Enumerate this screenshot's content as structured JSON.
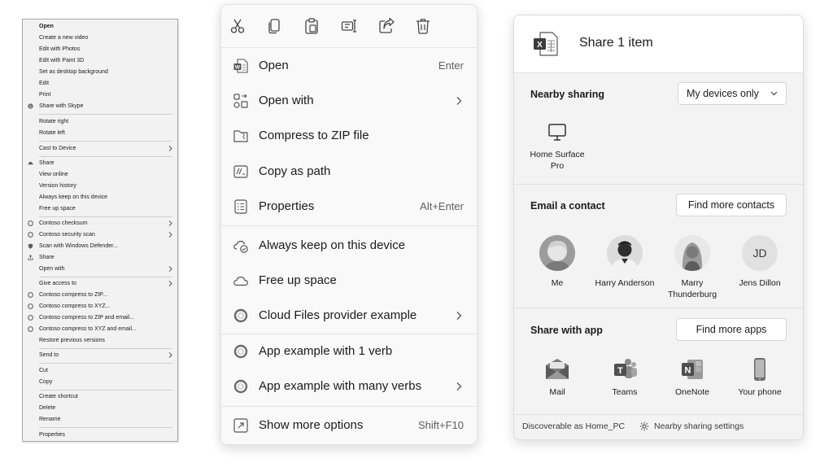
{
  "classic_menu": {
    "items": [
      {
        "label": "Open",
        "bold": true
      },
      {
        "label": "Create a new video"
      },
      {
        "label": "Edit with Photos"
      },
      {
        "label": "Edit with Paint 3D"
      },
      {
        "label": "Set as desktop background"
      },
      {
        "label": "Edit"
      },
      {
        "label": "Print"
      },
      {
        "label": "Share with Skype",
        "icon": "skype-icon"
      },
      {
        "label": "Rotate right"
      },
      {
        "label": "Rotate left"
      },
      {
        "label": "Cast to Device",
        "submenu": true
      },
      {
        "label": "Share",
        "icon": "onedrive-icon"
      },
      {
        "label": "View online"
      },
      {
        "label": "Version history"
      },
      {
        "label": "Always keep on this device"
      },
      {
        "label": "Free up space"
      },
      {
        "label": "Contoso checksum",
        "icon": "contoso-icon",
        "submenu": true
      },
      {
        "label": "Contoso security scan",
        "icon": "contoso-icon",
        "submenu": true
      },
      {
        "label": "Scan with Windows Defender...",
        "icon": "defender-shield-icon"
      },
      {
        "label": "Share",
        "icon": "share-icon"
      },
      {
        "label": "Open with",
        "submenu": true
      },
      {
        "label": "Give access to",
        "submenu": true
      },
      {
        "label": "Contoso compress to ZIP...",
        "icon": "contoso-icon"
      },
      {
        "label": "Contoso compress to XYZ...",
        "icon": "contoso-icon"
      },
      {
        "label": "Contoso compress to ZIP and email...",
        "icon": "contoso-icon"
      },
      {
        "label": "Contoso compress to XYZ and email...",
        "icon": "contoso-icon"
      },
      {
        "label": "Restore previous versions"
      },
      {
        "label": "Send to",
        "submenu": true
      },
      {
        "label": "Cut"
      },
      {
        "label": "Copy"
      },
      {
        "label": "Create shortcut"
      },
      {
        "label": "Delete"
      },
      {
        "label": "Rename"
      },
      {
        "label": "Properties"
      }
    ]
  },
  "modern_menu": {
    "toolbar": [
      "cut-icon",
      "copy-icon",
      "paste-icon",
      "rename-icon",
      "share-icon",
      "delete-icon"
    ],
    "items": [
      {
        "label": "Open",
        "icon": "word-doc-icon",
        "accel": "Enter"
      },
      {
        "label": "Open with",
        "icon": "open-with-icon",
        "submenu": true
      },
      {
        "label": "Compress to ZIP file",
        "icon": "zip-folder-icon"
      },
      {
        "label": "Copy as path",
        "icon": "copy-path-icon"
      },
      {
        "label": "Properties",
        "icon": "properties-icon",
        "accel": "Alt+Enter"
      },
      {
        "label": "Always keep on this device",
        "icon": "cloud-sync-icon"
      },
      {
        "label": "Free up space",
        "icon": "cloud-icon"
      },
      {
        "label": "Cloud Files provider example",
        "icon": "ring-icon",
        "submenu": true
      },
      {
        "label": "App example with 1 verb",
        "icon": "ring-icon"
      },
      {
        "label": "App example with many verbs",
        "icon": "ring-icon",
        "submenu": true
      },
      {
        "label": "Show more options",
        "icon": "show-more-icon",
        "accel": "Shift+F10"
      }
    ]
  },
  "share_dialog": {
    "title": "Share 1 item",
    "nearby_title": "Nearby sharing",
    "nearby_dropdown": "My devices only",
    "device_name": "Home Surface Pro",
    "email_title": "Email a contact",
    "find_contacts": "Find more contacts",
    "contacts": [
      {
        "name": "Me"
      },
      {
        "name": "Harry Anderson"
      },
      {
        "name": "Marry Thunderburg"
      },
      {
        "name": "Jens Dillon",
        "initials": "JD"
      }
    ],
    "app_title": "Share with app",
    "find_apps": "Find more apps",
    "apps": [
      {
        "name": "Mail"
      },
      {
        "name": "Teams"
      },
      {
        "name": "OneNote"
      },
      {
        "name": "Your phone"
      }
    ],
    "footer_discoverable": "Discoverable as Home_PC",
    "footer_settings": "Nearby sharing settings"
  }
}
